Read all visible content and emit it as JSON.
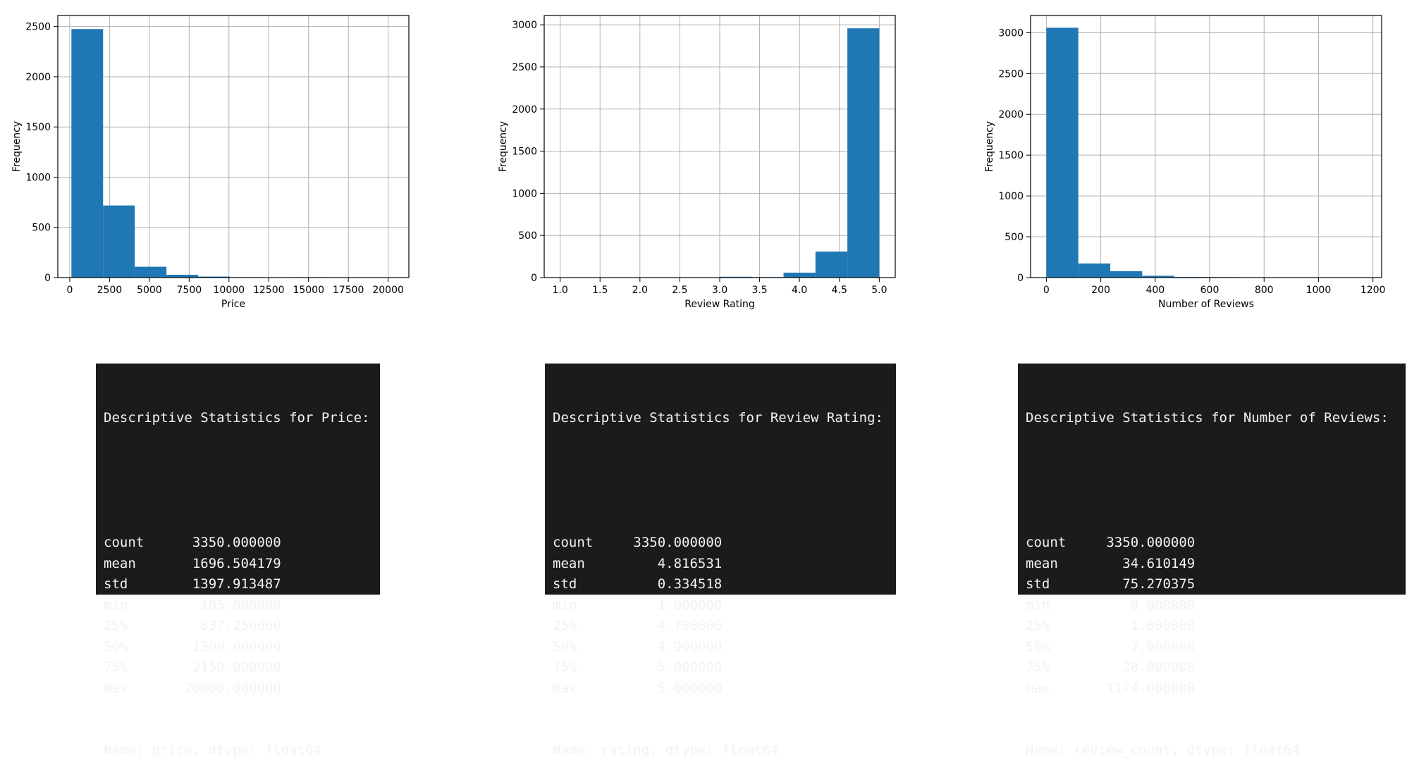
{
  "colors": {
    "bar": "#1f77b4",
    "grid": "#b0b0b0",
    "axis": "#000000",
    "panel": "#1b1b1b",
    "panel_text": "#f2f2f2"
  },
  "chart_data": [
    {
      "type": "bar",
      "subtype": "histogram",
      "title": "",
      "xlabel": "Price",
      "ylabel": "Frequency",
      "xlim": [
        -750,
        21300
      ],
      "ylim": [
        0,
        2610
      ],
      "xticks": [
        0,
        2500,
        5000,
        7500,
        10000,
        12500,
        15000,
        17500,
        20000
      ],
      "yticks": [
        0,
        500,
        1000,
        1500,
        2000,
        2500
      ],
      "grid": true,
      "bins": [
        105,
        2094.5,
        4084,
        6073.5,
        8063,
        10052.5,
        12042,
        14031.5,
        16021,
        18010.5,
        20000
      ],
      "values": [
        2475,
        718,
        108,
        28,
        10,
        4,
        1,
        4,
        1,
        1
      ]
    },
    {
      "type": "bar",
      "subtype": "histogram",
      "title": "",
      "xlabel": "Review Rating",
      "ylabel": "Frequency",
      "xlim": [
        0.8,
        5.2
      ],
      "ylim": [
        0,
        3110
      ],
      "xticks": [
        1.0,
        1.5,
        2.0,
        2.5,
        3.0,
        3.5,
        4.0,
        4.5,
        5.0
      ],
      "xtick_labels": [
        "1.0",
        "1.5",
        "2.0",
        "2.5",
        "3.0",
        "3.5",
        "4.0",
        "4.5",
        "5.0"
      ],
      "yticks": [
        0,
        500,
        1000,
        1500,
        2000,
        2500,
        3000
      ],
      "grid": true,
      "bins": [
        1.0,
        1.4,
        1.8,
        2.2,
        2.6,
        3.0,
        3.4,
        3.8,
        4.2,
        4.6,
        5.0
      ],
      "values": [
        4,
        0,
        3,
        3,
        0,
        10,
        6,
        58,
        308,
        2958
      ]
    },
    {
      "type": "bar",
      "subtype": "histogram",
      "title": "",
      "xlabel": "Number of Reviews",
      "ylabel": "Frequency",
      "xlim": [
        -58,
        1232
      ],
      "ylim": [
        0,
        3210
      ],
      "xticks": [
        0,
        200,
        400,
        600,
        800,
        1000,
        1200
      ],
      "yticks": [
        0,
        500,
        1000,
        1500,
        2000,
        2500,
        3000
      ],
      "grid": true,
      "bins": [
        0,
        117.4,
        234.8,
        352.2,
        469.6,
        587,
        704.4,
        821.8,
        939.2,
        1056.6,
        1174
      ],
      "values": [
        3060,
        172,
        78,
        22,
        8,
        6,
        1,
        1,
        1,
        1
      ]
    }
  ],
  "stats": [
    {
      "title": "Descriptive Statistics for Price:",
      "rows": [
        {
          "label": "count",
          "value": "3350.000000"
        },
        {
          "label": "mean",
          "value": "1696.504179"
        },
        {
          "label": "std",
          "value": "1397.913487"
        },
        {
          "label": "min",
          "value": "105.000000"
        },
        {
          "label": "25%",
          "value": "837.250000"
        },
        {
          "label": "50%",
          "value": "1300.000000"
        },
        {
          "label": "75%",
          "value": "2150.000000"
        },
        {
          "label": "max",
          "value": "20000.000000"
        }
      ],
      "footer": "Name: price, dtype: float64"
    },
    {
      "title": "Descriptive Statistics for Review Rating:",
      "rows": [
        {
          "label": "count",
          "value": "3350.000000"
        },
        {
          "label": "mean",
          "value": "4.816531"
        },
        {
          "label": "std",
          "value": "0.334518"
        },
        {
          "label": "min",
          "value": "1.000000"
        },
        {
          "label": "25%",
          "value": "4.790000"
        },
        {
          "label": "50%",
          "value": "4.900000"
        },
        {
          "label": "75%",
          "value": "5.000000"
        },
        {
          "label": "max",
          "value": "5.000000"
        }
      ],
      "footer": "Name: rating, dtype: float64"
    },
    {
      "title": "Descriptive Statistics for Number of Reviews:",
      "rows": [
        {
          "label": "count",
          "value": "3350.000000"
        },
        {
          "label": "mean",
          "value": "34.610149"
        },
        {
          "label": "std",
          "value": "75.270375"
        },
        {
          "label": "min",
          "value": "0.000000"
        },
        {
          "label": "25%",
          "value": "1.000000"
        },
        {
          "label": "50%",
          "value": "7.000000"
        },
        {
          "label": "75%",
          "value": "28.000000"
        },
        {
          "label": "max",
          "value": "1174.000000"
        }
      ],
      "footer": "Name: review_count, dtype: float64"
    }
  ]
}
